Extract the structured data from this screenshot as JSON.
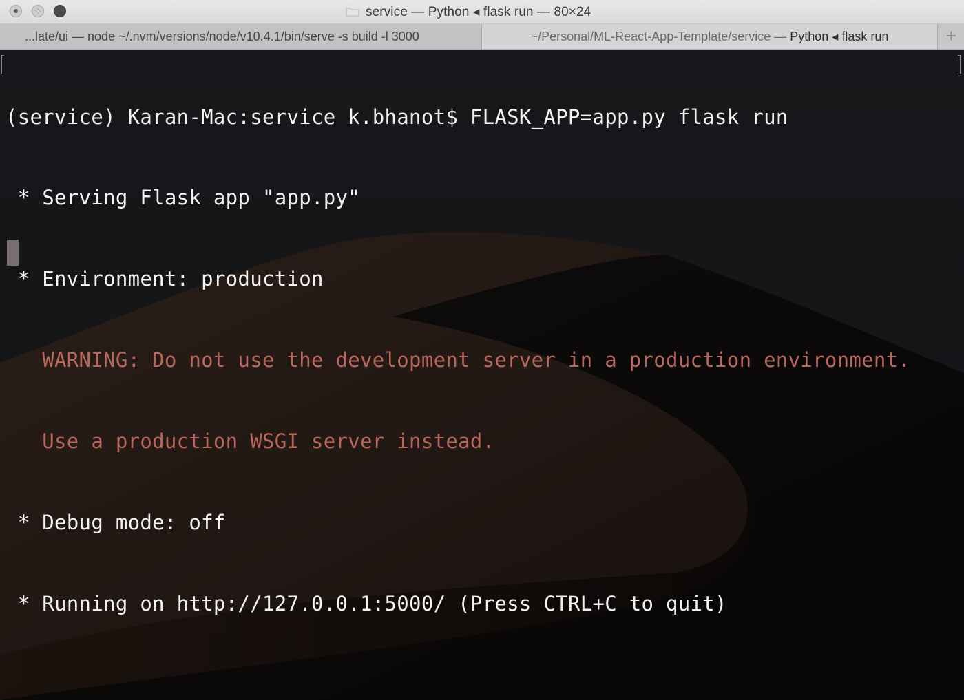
{
  "window": {
    "title": "service — Python ◂ flask run — 80×24"
  },
  "tabs": [
    {
      "label": "...late/ui — node ~/.nvm/versions/node/v10.4.1/bin/serve -s build -l 3000",
      "active": false
    },
    {
      "label_path": "~/Personal/ML-React-App-Template/service — ",
      "label_process": "Python ◂ flask run",
      "active": true
    }
  ],
  "new_tab_label": "+",
  "terminal": {
    "lines": [
      {
        "text": "(service) Karan-Mac:service k.bhanot$ FLASK_APP=app.py flask run",
        "style": "normal"
      },
      {
        "text": " * Serving Flask app \"app.py\"",
        "style": "normal"
      },
      {
        "text": " * Environment: production",
        "style": "normal"
      },
      {
        "text": "   WARNING: Do not use the development server in a production environment.",
        "style": "warning"
      },
      {
        "text": "   Use a production WSGI server instead.",
        "style": "warning"
      },
      {
        "text": " * Debug mode: off",
        "style": "normal"
      },
      {
        "text": " * Running on http://127.0.0.1:5000/ (Press CTRL+C to quit)",
        "style": "normal"
      }
    ]
  },
  "colors": {
    "text": "#f2f2f2",
    "warning": "#b8675c",
    "background": "#141416"
  },
  "icons": {
    "close": "close-button-icon",
    "minimize": "minimize-button-icon",
    "zoom": "zoom-button-icon",
    "folder": "folder-icon"
  }
}
